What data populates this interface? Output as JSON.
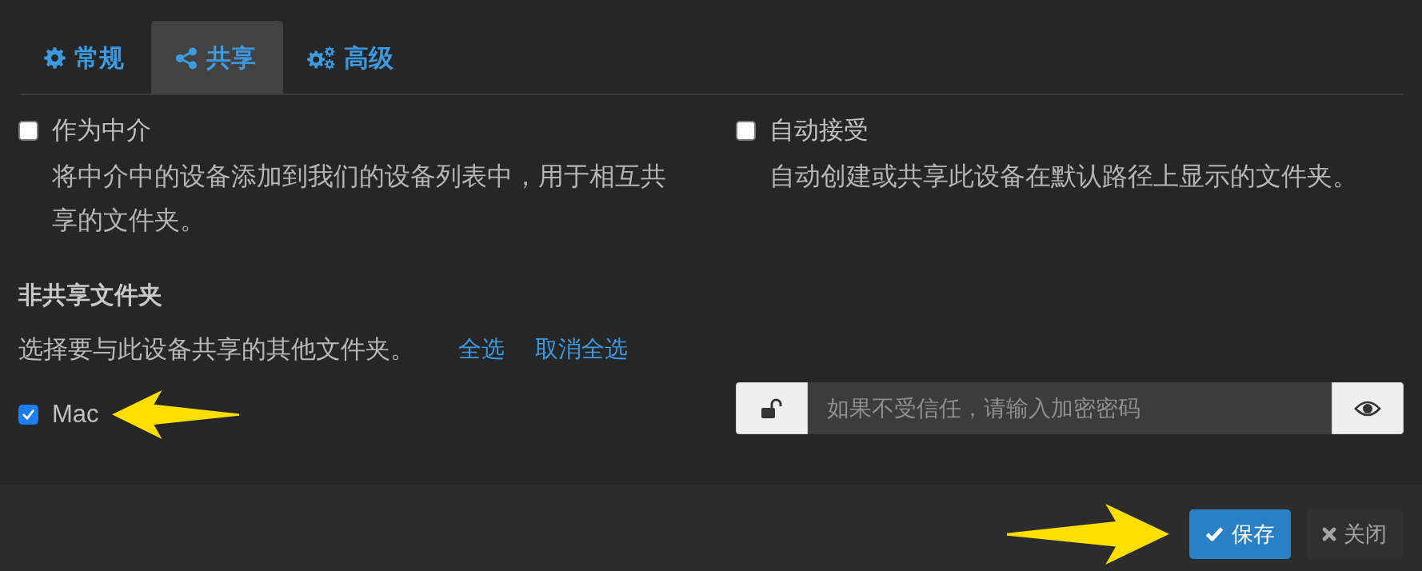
{
  "tabs": [
    {
      "label": "常规",
      "selected": false
    },
    {
      "label": "共享",
      "selected": true
    },
    {
      "label": "高级",
      "selected": false
    }
  ],
  "options": [
    {
      "label": "作为中介",
      "checked": false,
      "description": "将中介中的设备添加到我们的设备列表中，用于相互共享的文件夹。"
    },
    {
      "label": "自动接受",
      "checked": false,
      "description": "自动创建或共享此设备在默认路径上显示的文件夹。"
    }
  ],
  "unshared_folders": {
    "heading": "非共享文件夹",
    "hint": "选择要与此设备共享的其他文件夹。",
    "select_all": "全选",
    "deselect_all": "取消全选",
    "folders": [
      {
        "label": "Mac",
        "checked": true,
        "arrow": true
      }
    ]
  },
  "encryption_password": {
    "placeholder": "如果不受信任，请输入加密密码"
  },
  "footer": {
    "buttons": [
      {
        "label": "保存",
        "kind": "primary",
        "arrow": true
      },
      {
        "label": "关闭",
        "kind": "secondary",
        "arrow": false
      }
    ]
  }
}
